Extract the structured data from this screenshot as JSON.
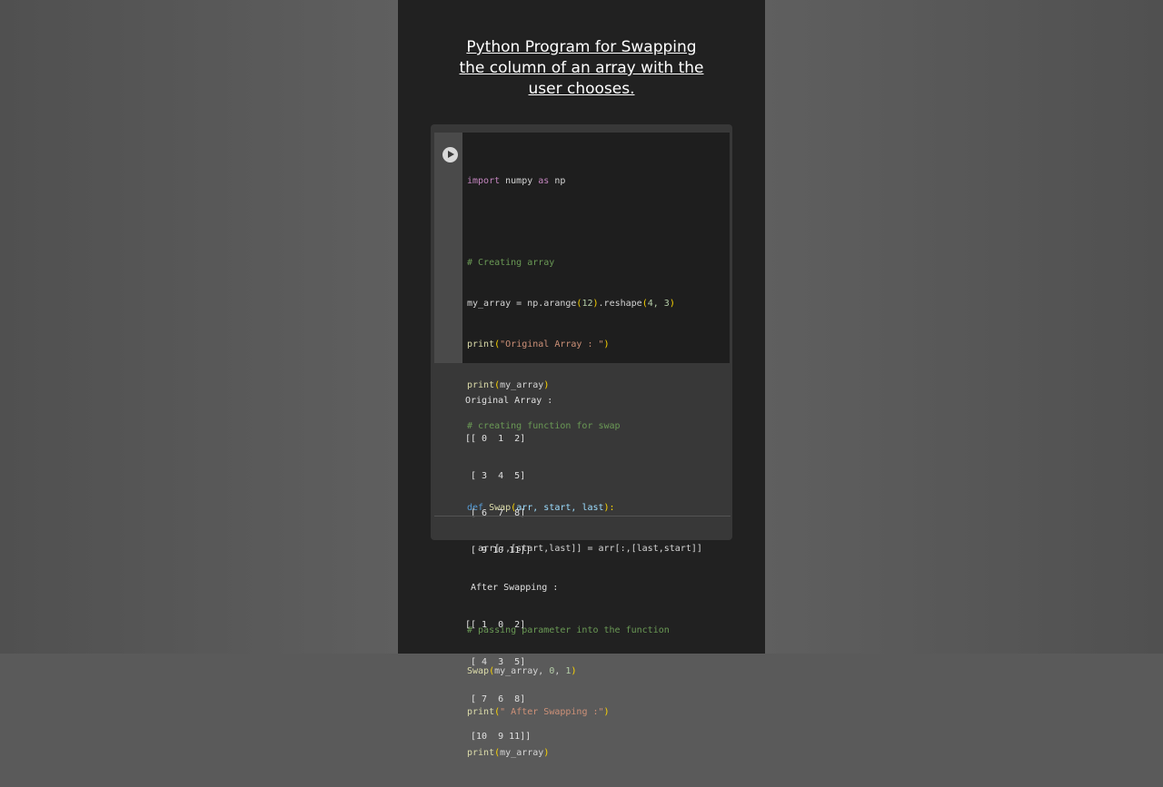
{
  "title_lines": [
    "Python Program for Swapping",
    "the column of an array with the",
    "user chooses."
  ],
  "code": {
    "line1": {
      "kw": "import",
      "mod": " numpy ",
      "as": "as",
      "alias": " np"
    },
    "line3": "# Creating array",
    "line4": {
      "var": "my_array = np.arange",
      "open": "(",
      "arg": "12",
      "close": ")",
      "mid": ".reshape",
      "open2": "(",
      "args": "4, 3",
      "close2": ")"
    },
    "line5": {
      "fn": "print",
      "open": "(",
      "str": "\"Original Array : \"",
      "close": ")"
    },
    "line6": {
      "fn": "print",
      "open": "(",
      "arg": "my_array",
      "close": ")"
    },
    "line7": "# creating function for swap",
    "line9": {
      "kw": "def",
      "name": " Swap",
      "open": "(",
      "params": "arr, start, last",
      "close": "):"
    },
    "line10": {
      "text": "  arr[:,[start,last]] = arr[:,[last,start]]"
    },
    "line12": "# passing parameter into the function",
    "line13": {
      "fn": "Swap",
      "open": "(",
      "arg": "my_array, ",
      "n1": "0",
      "sep": ", ",
      "n2": "1",
      "close": ")"
    },
    "line14": {
      "fn": "print",
      "open": "(",
      "str": "\" After Swapping :\"",
      "close": ")"
    },
    "line15": {
      "fn": "print",
      "open": "(",
      "arg": "my_array",
      "close": ")"
    }
  },
  "output_lines": [
    "Original Array :",
    "[[ 0  1  2]",
    " [ 3  4  5]",
    " [ 6  7  8]",
    " [ 9 10 11]]",
    " After Swapping :",
    "[[ 1  0  2]",
    " [ 4  3  5]",
    " [ 7  6  8]",
    " [10  9 11]]"
  ],
  "icons": {
    "run": "play-circle-icon"
  }
}
